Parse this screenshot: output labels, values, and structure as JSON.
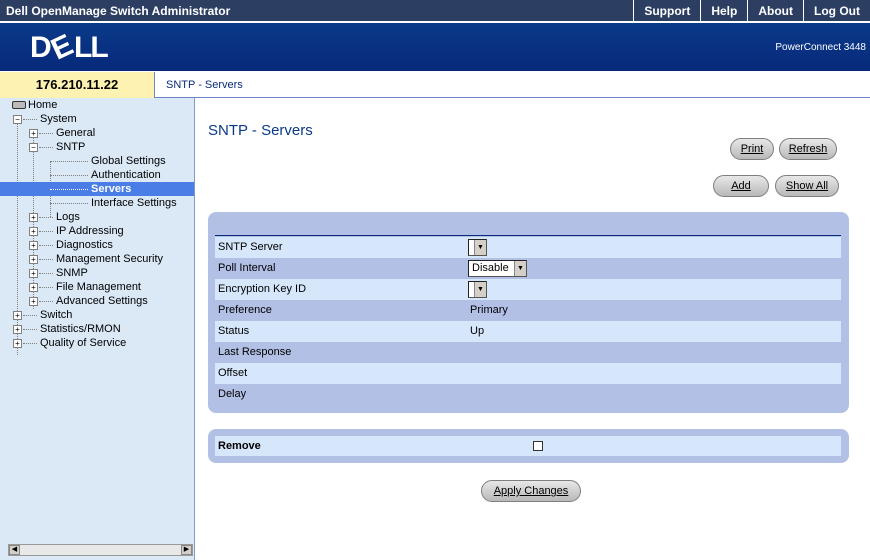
{
  "app": {
    "title": "Dell OpenManage Switch Administrator",
    "links": [
      "Support",
      "Help",
      "About",
      "Log Out"
    ],
    "model": "PowerConnect 3448"
  },
  "address": {
    "ip": "176.210.11.22",
    "breadcrumb": "SNTP - Servers"
  },
  "sidebar": {
    "home": "Home",
    "system": "System",
    "general": "General",
    "sntp": "SNTP",
    "global_settings": "Global Settings",
    "authentication": "Authentication",
    "servers": "Servers",
    "interface_settings": "Interface Settings",
    "logs": "Logs",
    "ip_addressing": "IP Addressing",
    "diagnostics": "Diagnostics",
    "management_security": "Management Security",
    "snmp": "SNMP",
    "file_management": "File Management",
    "advanced_settings": "Advanced Settings",
    "switch": "Switch",
    "statistics_rmon": "Statistics/RMON",
    "quality_of_service": "Quality of Service"
  },
  "main": {
    "title": "SNTP - Servers",
    "buttons": {
      "print": "Print",
      "refresh": "Refresh",
      "add": "Add",
      "show_all": "Show All",
      "apply": "Apply Changes"
    }
  },
  "form": {
    "sntp_server": {
      "label": "SNTP Server",
      "value": ""
    },
    "poll_interval": {
      "label": "Poll Interval",
      "value": "Disable"
    },
    "encryption_key_id": {
      "label": "Encryption Key ID",
      "value": ""
    },
    "preference": {
      "label": "Preference",
      "value": "Primary"
    },
    "status": {
      "label": "Status",
      "value": "Up"
    },
    "last_response": {
      "label": "Last Response",
      "value": ""
    },
    "offset": {
      "label": "Offset",
      "value": ""
    },
    "delay": {
      "label": "Delay",
      "value": ""
    }
  },
  "remove": {
    "label": "Remove",
    "checked": false
  },
  "colors": {
    "topbar": "#2c3e62",
    "banner": "#0a3a8a",
    "panel": "#b3c0e6",
    "row_alt": "#d6e7fb",
    "sidebar": "#dbe9f7",
    "selected": "#4a7ee6"
  }
}
